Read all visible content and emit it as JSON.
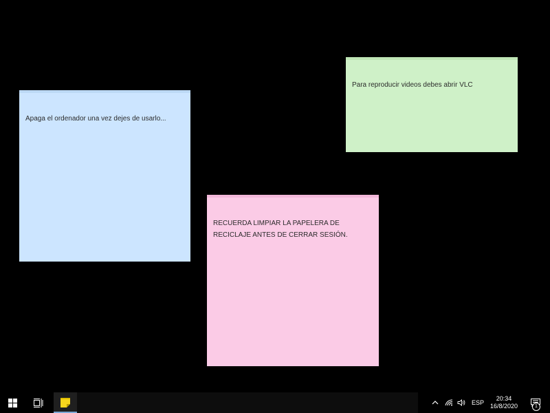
{
  "notes": {
    "blue": {
      "text": "Apaga el ordenador una vez dejes de usarlo...",
      "color": "#cce5ff",
      "bar_color": "#bcd9f5"
    },
    "green": {
      "text": "Para reproducir videos debes abrir VLC",
      "color": "#cff1c8",
      "bar_color": "#bfe6b6"
    },
    "pink": {
      "text": "RECUERDA LIMPIAR LA PAPELERA DE\nRECICLAJE ANTES DE CERRAR SESIÓN.",
      "color": "#fbcbe6",
      "bar_color": "#f2b7d9"
    }
  },
  "taskbar": {
    "start_icon": "windows-logo-icon",
    "taskview_icon": "task-view-icon",
    "pinned_app_icon": "sticky-notes-icon",
    "tray": {
      "chevron_icon": "chevron-up-icon",
      "network_icon": "wifi-icon",
      "volume_icon": "speaker-icon",
      "language": "ESP",
      "time": "20:34",
      "date": "16/8/2020",
      "notification_icon": "action-center-icon",
      "notification_count": "1"
    }
  }
}
